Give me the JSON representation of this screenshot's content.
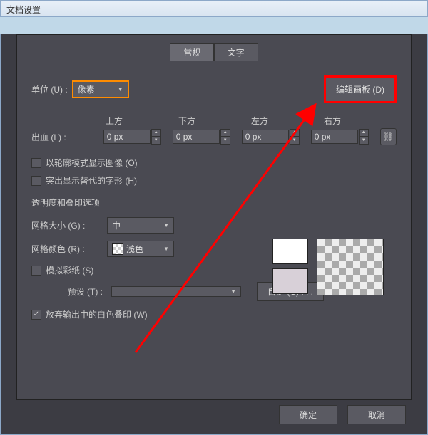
{
  "window": {
    "title": "文档设置"
  },
  "tabs": {
    "general": "常规",
    "text": "文字"
  },
  "unit": {
    "label": "单位 (U) :",
    "value": "像素"
  },
  "edit_artboard": {
    "label": "编辑画板 (D)"
  },
  "bleed": {
    "label": "出血 (L) :",
    "headers": {
      "top": "上方",
      "bottom": "下方",
      "left": "左方",
      "right": "右方"
    },
    "values": {
      "top": "0 px",
      "bottom": "0 px",
      "left": "0 px",
      "right": "0 px"
    }
  },
  "checkboxes": {
    "outline_mode": "以轮廓模式显示图像 (O)",
    "highlight_sub": "突出显示替代的字形 (H)",
    "simulate_paper": "模拟彩纸 (S)",
    "discard_white": "放弃输出中的白色叠印 (W)"
  },
  "section": {
    "transparency": "透明度和叠印选项"
  },
  "grid_size": {
    "label": "网格大小 (G) :",
    "value": "中"
  },
  "grid_color": {
    "label": "网格颜色 (R) :",
    "value": "浅色"
  },
  "preset": {
    "label": "预设 (T) :",
    "custom": "自定 (C) . . ."
  },
  "buttons": {
    "ok": "确定",
    "cancel": "取消"
  }
}
